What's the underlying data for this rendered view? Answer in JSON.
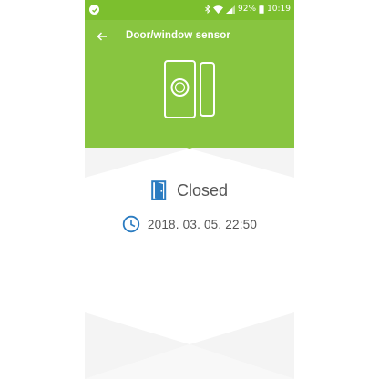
{
  "status_bar": {
    "battery_percent": "92%",
    "time": "10:19",
    "icons": [
      "notification-check-icon",
      "bluetooth-icon",
      "wifi-icon",
      "signal-icon",
      "battery-icon"
    ]
  },
  "header": {
    "back_icon": "arrow-left-icon",
    "title": "Door/window sensor",
    "illustration": "door-window-sensor-icon"
  },
  "sensor": {
    "state_icon": "door-closed-icon",
    "state": "Closed",
    "time_icon": "clock-icon",
    "last_changed": "2018. 03. 05. 22:50"
  },
  "colors": {
    "status_bar": "#7cbf2e",
    "header": "#88c540",
    "accent_blue": "#2b7cc1",
    "text": "#555555",
    "pattern_light": "#f5f5f5"
  }
}
